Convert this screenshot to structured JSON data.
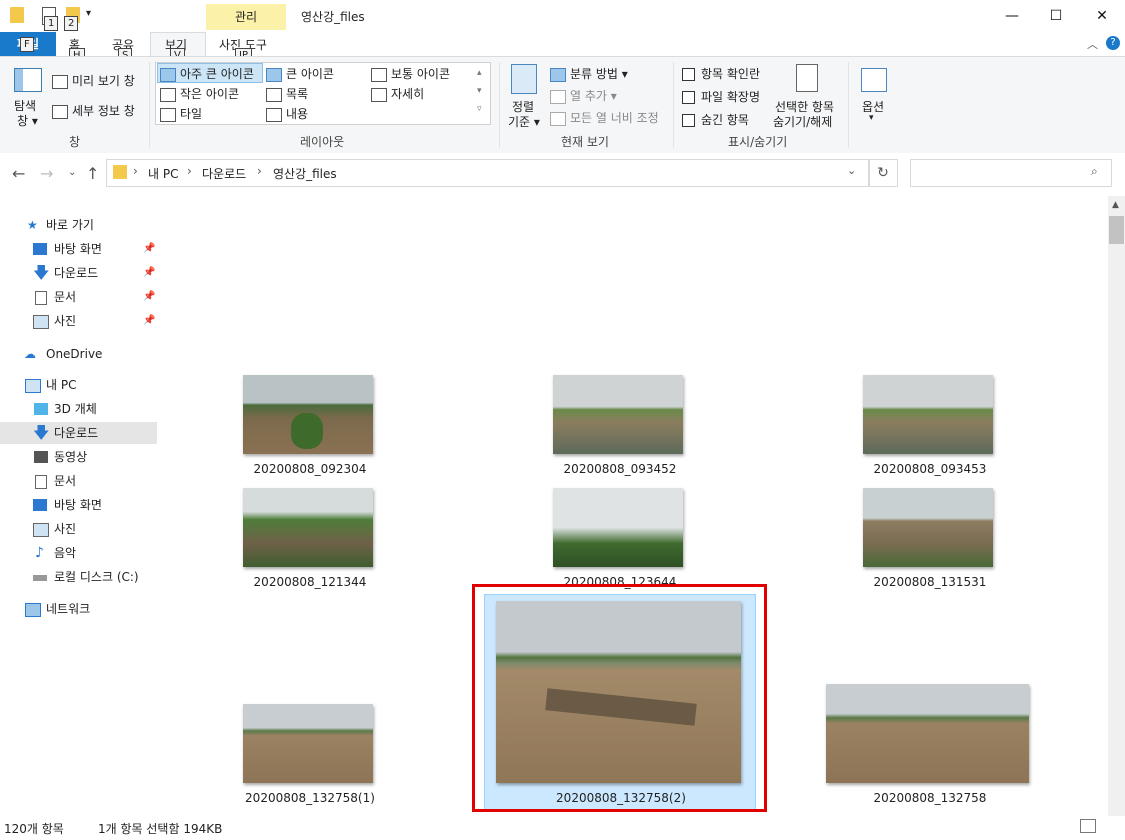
{
  "window": {
    "title": "영산강_files",
    "context_tab": "관리",
    "min_icon": "minimize-icon",
    "max_icon": "maximize-icon",
    "close_icon": "close-icon"
  },
  "quick_access_keytips": [
    "1",
    "2"
  ],
  "ribbon_tabs": {
    "file": "파일",
    "file_keytip": "F",
    "home": "홈",
    "home_keytip": "H",
    "share": "공유",
    "share_keytip": "S",
    "view": "보기",
    "view_keytip": "V",
    "picture_tools": "사진 도구",
    "picture_tools_keytip": "JP"
  },
  "ribbon": {
    "pane": {
      "nav_pane": "탐색",
      "nav_pane2": "창",
      "preview": "미리 보기 창",
      "details": "세부 정보 창",
      "label": "창"
    },
    "layout": {
      "extra_large": "아주 큰 아이콘",
      "large": "큰 아이콘",
      "medium": "보통 아이콘",
      "small": "작은 아이콘",
      "list": "목록",
      "details": "자세히",
      "tiles": "타일",
      "content": "내용",
      "label": "레이아웃"
    },
    "current_view": {
      "sort1": "정렬",
      "sort2": "기준",
      "group_by": "분류 방법",
      "add_columns": "열 추가",
      "size_all": "모든 열 너비 조정",
      "label": "현재 보기"
    },
    "show_hide": {
      "item_checkboxes": "항목 확인란",
      "file_ext": "파일 확장명",
      "hidden_items": "숨긴 항목",
      "hide_selected1": "선택한 항목",
      "hide_selected2": "숨기기/해제",
      "label": "표시/숨기기"
    },
    "options": {
      "label": "옵션"
    }
  },
  "address": {
    "crumbs": [
      "내 PC",
      "다운로드",
      "영산강_files"
    ]
  },
  "nav_pane": {
    "quick_access": "바로 가기",
    "quick_items": [
      "바탕 화면",
      "다운로드",
      "문서",
      "사진"
    ],
    "onedrive": "OneDrive",
    "this_pc": "내 PC",
    "pc_items": [
      "3D 개체",
      "다운로드",
      "동영상",
      "문서",
      "바탕 화면",
      "사진",
      "음악",
      "로컬 디스크 (C:)"
    ],
    "network": "네트워크"
  },
  "files": [
    {
      "name": "20200808_092304"
    },
    {
      "name": "20200808_093452"
    },
    {
      "name": "20200808_093453"
    },
    {
      "name": "20200808_121344"
    },
    {
      "name": "20200808_123644"
    },
    {
      "name": "20200808_131531"
    },
    {
      "name": "20200808_132758(1)"
    },
    {
      "name": "20200808_132758(2)",
      "selected": true
    },
    {
      "name": "20200808_132758"
    }
  ],
  "status": {
    "count": "120개 항목",
    "selection": "1개 항목 선택함 194KB"
  },
  "colors": {
    "file_tab": "#1979ca",
    "selection": "#cce8ff",
    "highlight": "#e00000"
  }
}
